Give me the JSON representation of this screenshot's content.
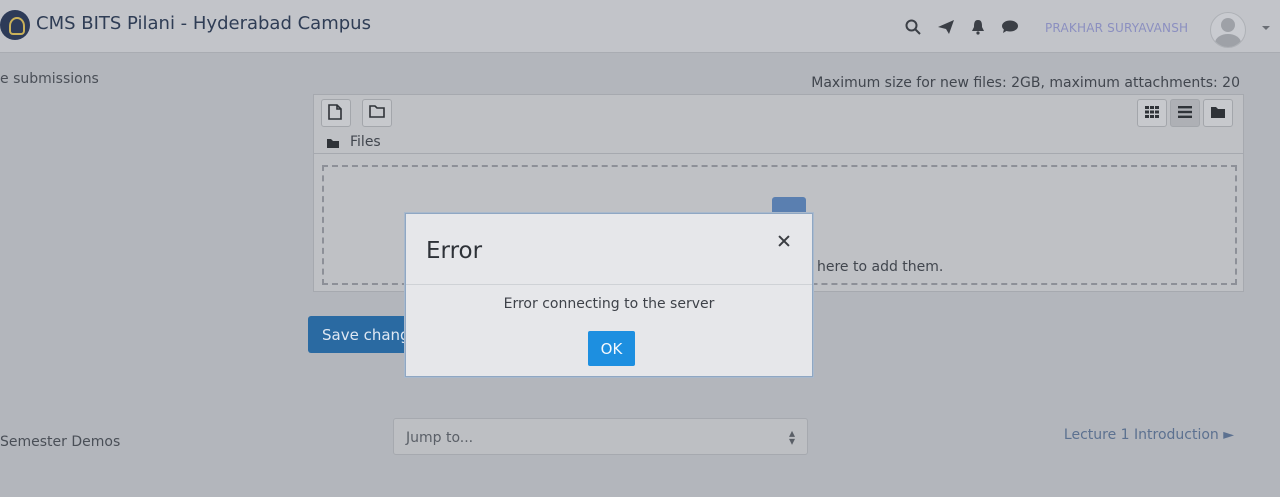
{
  "navbar": {
    "site_title": "CMS BITS Pilani - Hyderabad Campus",
    "user_name": "PRAKHAR SURYAVANSH",
    "icons": [
      "search-icon",
      "send-icon",
      "bell-icon",
      "chat-icon"
    ]
  },
  "page": {
    "submissions_label": "e submissions",
    "maxsize_text": "Maximum size for new files: 2GB, maximum attachments: 20",
    "files_label": "Files",
    "drop_text": "here to add them.",
    "save_label": "Save chang"
  },
  "footer": {
    "left_link": "Semester Demos",
    "jump_placeholder": "Jump to...",
    "right_link": "Lecture 1 Introduction ►"
  },
  "modal": {
    "title": "Error",
    "message": "Error connecting to the server",
    "ok_label": "OK"
  },
  "colors": {
    "primary_button": "#2a6aa2",
    "ok_button": "#1d8fe0"
  }
}
